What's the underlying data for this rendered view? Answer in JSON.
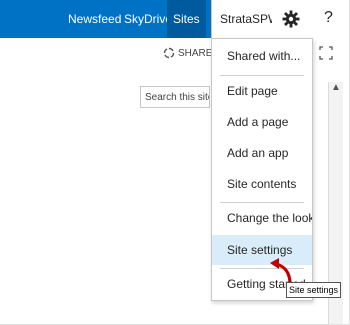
{
  "suitebar": {
    "links": [
      "Newsfeed",
      "SkyDrive",
      "Sites"
    ],
    "user_name": "StrataSPWeb",
    "help": "?",
    "brand_color": "#0072c6"
  },
  "toolbar": {
    "share_label": "SHARE"
  },
  "search": {
    "placeholder": "Search this site"
  },
  "menu": {
    "items": [
      "Shared with...",
      "Edit page",
      "Add a page",
      "Add an app",
      "Site contents",
      "Change the look",
      "Site settings",
      "Getting started"
    ],
    "hover_item": "Site settings"
  },
  "tooltip": {
    "text": "Site settings"
  },
  "icons": {
    "gear": "gear-icon",
    "share": "share-icon",
    "focus": "focus-content-icon",
    "scroll_up": "scroll-up-arrow",
    "pointer": "curved-arrow-pointer"
  }
}
